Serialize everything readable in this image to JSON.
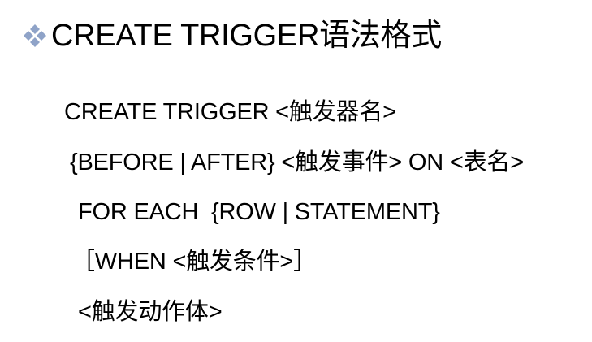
{
  "slide": {
    "bullet_icon": "diamond-dots-bullet-icon",
    "bullet_color": "#8FA3C8",
    "title": "CREATE TRIGGER语法格式",
    "lines": [
      "CREATE TRIGGER <触发器名>",
      "{BEFORE | AFTER} <触发事件> ON <表名>",
      "FOR EACH  {ROW | STATEMENT}",
      "［WHEN <触发条件>］",
      "<触发动作体>"
    ]
  }
}
